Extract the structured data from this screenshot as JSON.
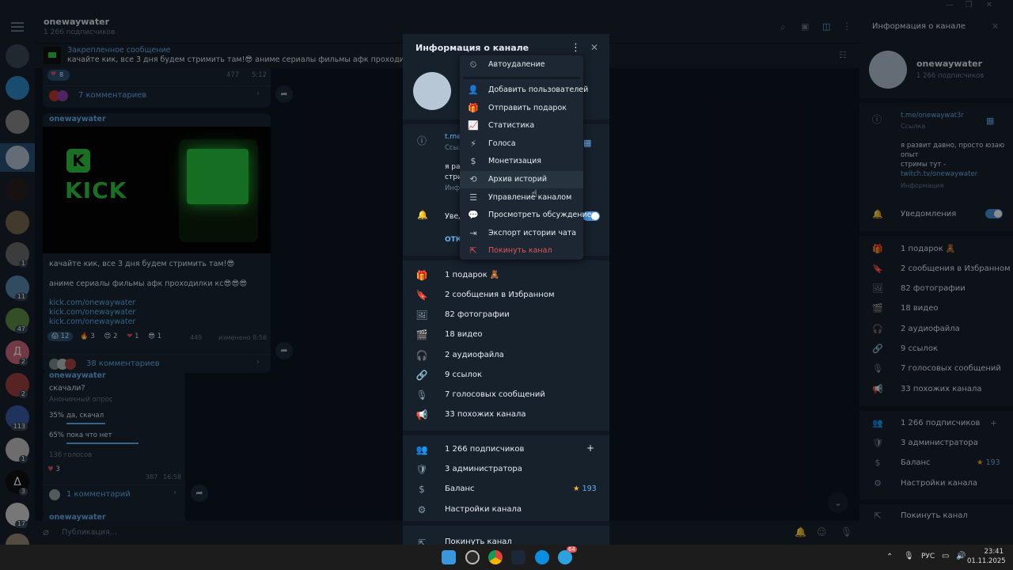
{
  "colors": {
    "accent": "#6ab2f2",
    "danger": "#e2545a",
    "gold": "#f4b93e",
    "toggle_on": "#4a90d9"
  },
  "chat": {
    "title": "onewaywater",
    "subtitle": "1 266 подписчиков",
    "pinned_title": "Закрепленное сообщение",
    "pinned_text": "качайте кик, все 3 дня будем стримить там!😎 аниме сериалы фильмы афк проходилки кс😎😎😎",
    "post1": {
      "reaction_count": "8",
      "views": "477",
      "time": "5:12",
      "comments": "7 комментариев"
    },
    "post2": {
      "author": "onewaywater",
      "kick_word": "KICK",
      "kick_letter": "K",
      "line1": "качайте кик, все 3 дня будем стримить там!😎",
      "line2": "аниме сериалы фильмы афк проходилки кс😎😎😎",
      "links": [
        "kick.com/onewaywater",
        "kick.com/onewaywater",
        "kick.com/onewaywater"
      ],
      "reactions": [
        {
          "emoji": "😱",
          "count": "12"
        },
        {
          "emoji": "🔥",
          "count": "3"
        },
        {
          "emoji": "😍",
          "count": "2"
        },
        {
          "emoji": "❤",
          "count": "1"
        },
        {
          "emoji": "😎",
          "count": "1"
        }
      ],
      "views": "449",
      "edited": "изменено 8:56",
      "comments": "38 комментариев"
    },
    "post3": {
      "author": "onewaywater",
      "question": "скачали?",
      "poll_type": "Анонимный опрос",
      "options": [
        {
          "pct": "35%",
          "label": "да, скачал",
          "fill": 0.35
        },
        {
          "pct": "65%",
          "label": "пока что нет",
          "fill": 0.65
        }
      ],
      "votes": "136 голосов",
      "reaction_count": "3",
      "views": "387",
      "time": "16:58",
      "comments": "1 комментарий"
    },
    "post4_author": "onewaywater",
    "composer_placeholder": "Публикация..."
  },
  "rail": {
    "badges": [
      "1",
      "11",
      "47",
      "2",
      "2",
      "113",
      "1",
      "3",
      "17"
    ],
    "letter_avatar": "Д",
    "delta_avatar": "Δ"
  },
  "modal": {
    "title": "Информация о канале",
    "link_short": "t.me",
    "link_sub": "Ссыл",
    "about_short1": "я раз",
    "about_short2": "стри",
    "about_short3": "Инф",
    "notif_short": "Увед",
    "off_short": "ОТКЛ",
    "media": [
      {
        "icon": "🎁",
        "label": "1 подарок 🧸"
      },
      {
        "icon": "🔖",
        "label": "2 сообщения в Избранном"
      },
      {
        "icon": "🖼",
        "label": "82 фотографии"
      },
      {
        "icon": "🎬",
        "label": "18 видео"
      },
      {
        "icon": "🎧",
        "label": "2 аудиофайла"
      },
      {
        "icon": "🔗",
        "label": "9 ссылок"
      },
      {
        "icon": "🎙",
        "label": "7 голосовых сообщений"
      },
      {
        "icon": "📢",
        "label": "33 похожих канала"
      }
    ],
    "admin": [
      {
        "icon": "👥",
        "label": "1 266 подписчиков"
      },
      {
        "icon": "🛡",
        "label": "3 администратора"
      },
      {
        "icon": "$",
        "label": "Баланс"
      },
      {
        "icon": "⚙",
        "label": "Настройки канала"
      }
    ],
    "balance": "193",
    "leave": "Покинуть канал"
  },
  "dropdown": {
    "items": [
      {
        "icon": "⏲",
        "label": "Автоудаление"
      },
      {
        "icon": "👤",
        "label": "Добавить пользователей"
      },
      {
        "icon": "🎁",
        "label": "Отправить подарок"
      },
      {
        "icon": "📈",
        "label": "Статистика"
      },
      {
        "icon": "⚡",
        "label": "Голоса"
      },
      {
        "icon": "$",
        "label": "Монетизация"
      },
      {
        "icon": "⟲",
        "label": "Архив историй"
      },
      {
        "icon": "☰",
        "label": "Управление каналом"
      },
      {
        "icon": "💬",
        "label": "Просмотреть обсуждение"
      },
      {
        "icon": "⇥",
        "label": "Экспорт истории чата"
      },
      {
        "icon": "⇱",
        "label": "Покинуть канал"
      }
    ]
  },
  "right": {
    "header": "Информация о канале",
    "name": "onewaywater",
    "subs": "1 266 подписчиков",
    "link": "t.me/onewaywat3r",
    "link_label": "Ссылка",
    "about1": "я развит давно, просто юзаю",
    "about2": "опыт",
    "about3": "стримы тут -",
    "about_link": "twitch.tv/onewaywater",
    "about_label": "Информация",
    "notifications": "Уведомления",
    "media": [
      {
        "icon": "🎁",
        "label": "1 подарок 🧸"
      },
      {
        "icon": "🔖",
        "label": "2 сообщения в Избранном"
      },
      {
        "icon": "🖼",
        "label": "82 фотографии"
      },
      {
        "icon": "🎬",
        "label": "18 видео"
      },
      {
        "icon": "🎧",
        "label": "2 аудиофайла"
      },
      {
        "icon": "🔗",
        "label": "9 ссылок"
      },
      {
        "icon": "🎙",
        "label": "7 голосовых сообщений"
      },
      {
        "icon": "📢",
        "label": "33 похожих канала"
      }
    ],
    "admin": [
      {
        "icon": "👥",
        "label": "1 266 подписчиков"
      },
      {
        "icon": "🛡",
        "label": "3 администратора"
      },
      {
        "icon": "$",
        "label": "Баланс"
      },
      {
        "icon": "⚙",
        "label": "Настройки канала"
      }
    ],
    "balance": "193",
    "leave": "Покинуть канал"
  },
  "taskbar": {
    "lang": "РУС",
    "time": "23:41",
    "date": "01.11.2025",
    "tg_badge": "64"
  }
}
